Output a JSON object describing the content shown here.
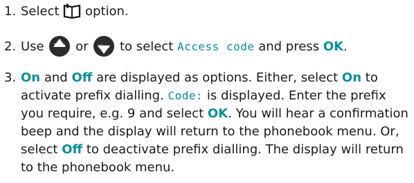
{
  "step1": {
    "number": "1.",
    "before": "Select",
    "icon": "phonebook-icon",
    "after": "option."
  },
  "step2": {
    "number": "2.",
    "use": "Use",
    "up_icon": "nav-up-menu-icon",
    "or": "or",
    "down_icon": "nav-down-menu-icon",
    "to_select": "to select",
    "display_text": "Access code",
    "and_press": "and press",
    "ok": "OK",
    "end": "."
  },
  "step3": {
    "number": "3.",
    "on": "On",
    "and": "and",
    "off": "Off",
    "t1": "are displayed as options. Either, select",
    "on2": "On",
    "t2": "to activate prefix dialling.",
    "code_display": "Code:",
    "t3": "is displayed. Enter the prefix you require, e.g. 9 and select",
    "ok": "OK",
    "t4": ". You will hear a confirmation beep and the display will return to the phonebook menu. Or, select",
    "off2": "Off",
    "t5": "to deactivate prefix dialling. The display will return to the phonebook menu."
  },
  "colors": {
    "accent": "#0a8f93",
    "text": "#1a1a1a"
  }
}
